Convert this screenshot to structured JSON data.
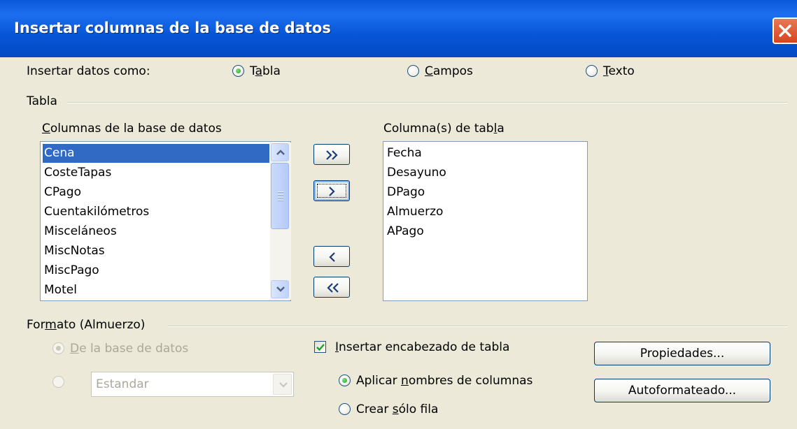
{
  "window": {
    "title": "Insertar columnas de la base de datos"
  },
  "insert_as": {
    "label": "Insertar datos como:",
    "options": [
      {
        "pre": "T",
        "key": "a",
        "post": "bla",
        "checked": true
      },
      {
        "pre": "",
        "key": "C",
        "post": "ampos",
        "checked": false
      },
      {
        "pre": "",
        "key": "T",
        "post": "exto",
        "checked": false
      }
    ]
  },
  "table_group": {
    "label": "Tabla"
  },
  "db_columns": {
    "label_key": "C",
    "label_rest": "olumnas de la base de datos",
    "items": [
      "Cena",
      "CosteTapas",
      "CPago",
      "Cuentakilómetros",
      "Misceláneos",
      "MiscNotas",
      "MiscPago",
      "Motel"
    ],
    "selected": "Cena"
  },
  "table_columns": {
    "label_pre": "Columna(s) de tab",
    "label_key": "l",
    "label_post": "a",
    "items": [
      "Fecha",
      "Desayuno",
      "DPago",
      "Almuerzo",
      "APago"
    ]
  },
  "move_buttons": {
    "all_right": "»",
    "one_right": "›",
    "one_left": "‹",
    "all_left": "«"
  },
  "format_group": {
    "label_pre": "For",
    "label_key": "m",
    "label_post": "ato (Almuerzo)",
    "from_db": {
      "key": "D",
      "rest": "e la base de datos",
      "checked": true
    },
    "custom": {
      "checked": false,
      "value": "Estandar"
    }
  },
  "header_options": {
    "insert_header": {
      "key": "I",
      "rest": "nsertar encabezado de tabla",
      "checked": true
    },
    "apply_names": {
      "pre": "Aplicar ",
      "key": "n",
      "post": "ombres de columnas",
      "checked": true
    },
    "create_row": {
      "pre": "Crear ",
      "key": "s",
      "post": "ólo fila",
      "checked": false
    }
  },
  "buttons": {
    "properties": "Propiedades...",
    "autoformat": "Autoformateado..."
  }
}
